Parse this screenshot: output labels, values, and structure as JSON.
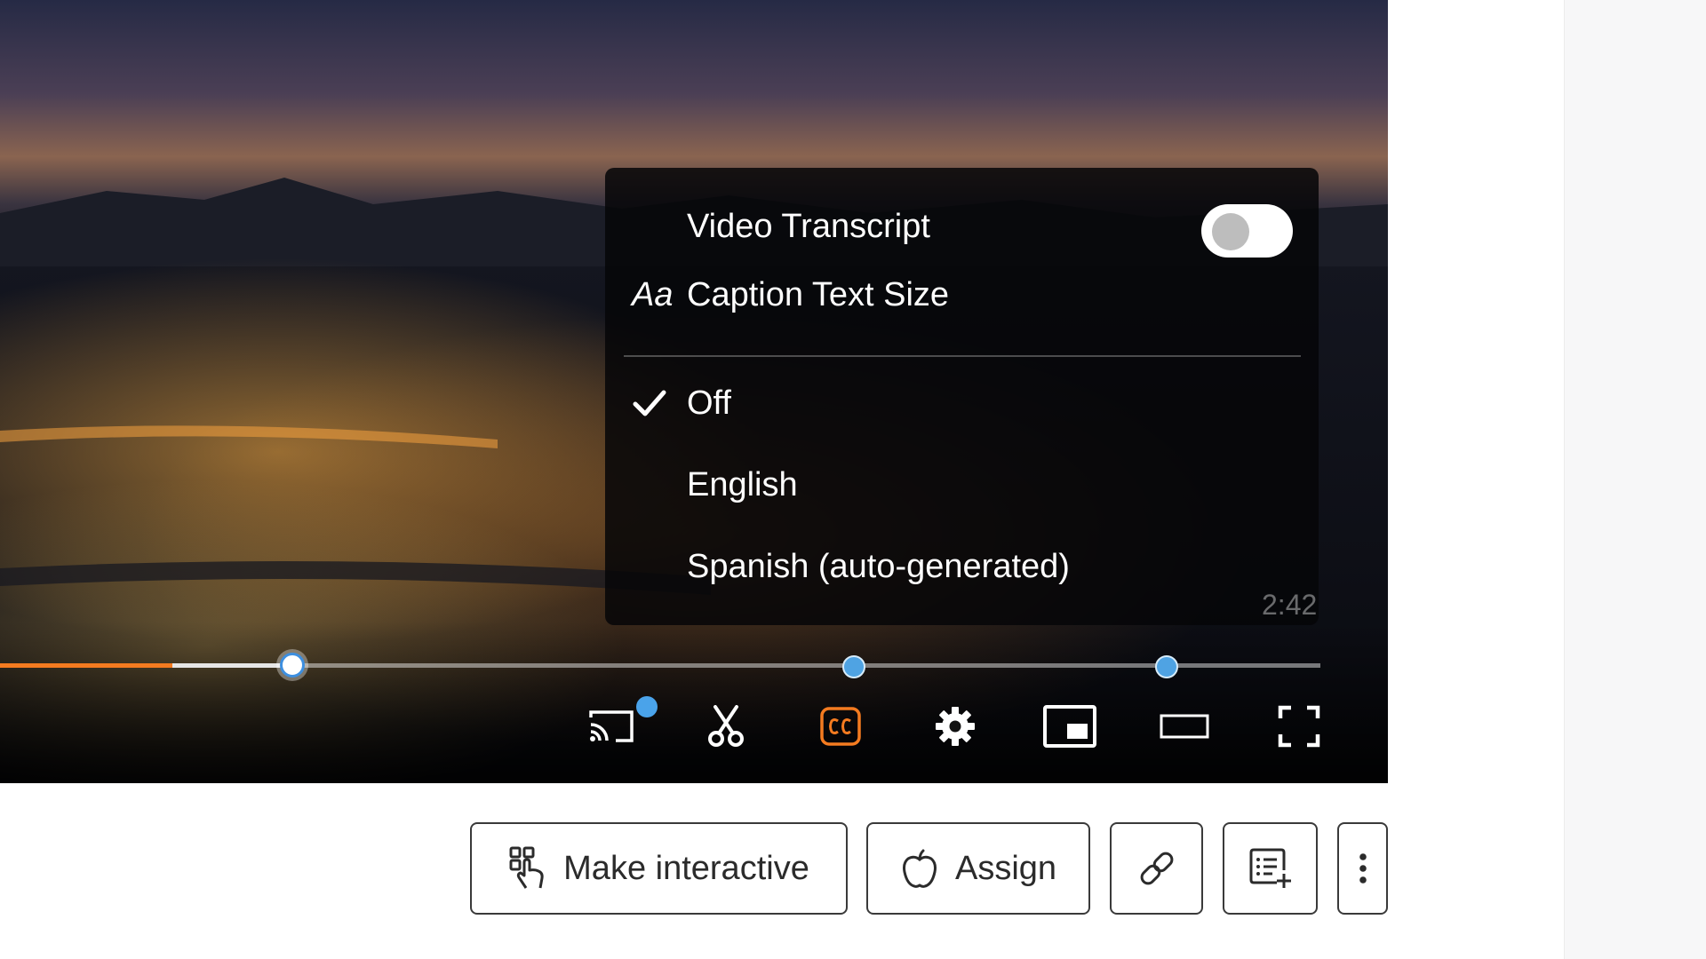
{
  "menu": {
    "transcript_label": "Video Transcript",
    "transcript_enabled": false,
    "caption_size_icon": "Aa",
    "caption_size_label": "Caption Text Size",
    "options": [
      {
        "label": "Off",
        "selected": true
      },
      {
        "label": "English",
        "selected": false
      },
      {
        "label": "Spanish (auto-generated)",
        "selected": false
      }
    ]
  },
  "player": {
    "time_display": "2:42",
    "progress_fraction": 0.13,
    "buffered_fraction": 0.22,
    "accent_color": "#f47b20",
    "marker_color": "#4fa3e3",
    "controls": [
      "cast-icon",
      "scissors-icon",
      "cc-icon",
      "gear-icon",
      "miniplayer-icon",
      "theater-mode-icon",
      "fullscreen-icon"
    ]
  },
  "actions": {
    "make_interactive": "Make interactive",
    "assign": "Assign"
  }
}
